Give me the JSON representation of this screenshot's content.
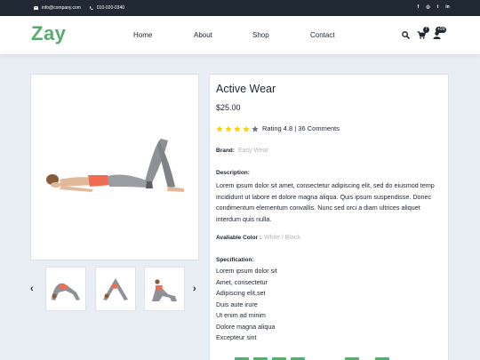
{
  "topbar": {
    "email": "info@company.com",
    "phone": "010-020-0340",
    "socials": [
      "facebook-icon",
      "instagram-icon",
      "twitter-icon",
      "linkedin-icon"
    ]
  },
  "nav": {
    "logo": "Zay",
    "menu": [
      "Home",
      "About",
      "Shop",
      "Contact"
    ],
    "cart_count": "7",
    "user_count": "+99"
  },
  "product": {
    "title": "Active Wear",
    "price": "$25.00",
    "rating_text": "Rating 4.8 | 36 Comments",
    "rating": 4,
    "rating_max": 5,
    "brand_label": "Brand:",
    "brand_value": "Easy Wear",
    "description_label": "Description:",
    "description": "Lorem ipsum dolor sit amet, consectetur adipiscing elit, sed do eiusmod temp incididunt ut labore et dolore magna aliqua. Quis ipsum suspendisse. Donec condimentum elementum convallis. Nunc sed orci a diam ultrices aliquet interdum quis nulla.",
    "color_label": "Avaliable Color :",
    "color_value": "White / Black",
    "spec_label": "Specification:",
    "spec_items": [
      "Lorem ipsum dolor sit",
      "Amet, consectetur",
      "Adipiscing elit,set",
      "Duis aute irure",
      "Ut enim ad minim",
      "Dolore magna aliqua",
      "Excepteur sint"
    ]
  },
  "gallery": {
    "prev": "‹",
    "next": "›"
  },
  "colors": {
    "brand": "#59ab6e",
    "dark": "#212934",
    "star": "#f8d10b",
    "star_empty": "#6c757d"
  }
}
